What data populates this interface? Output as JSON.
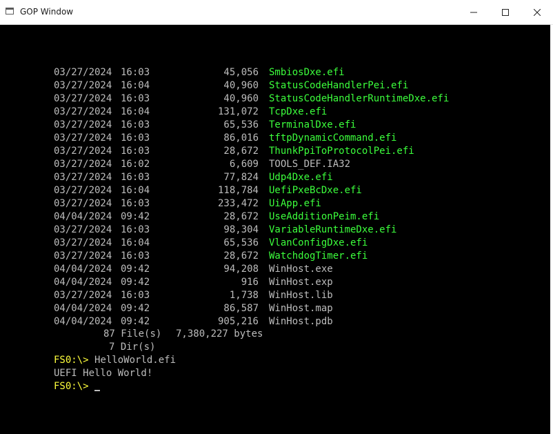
{
  "window": {
    "title": "GOP Window",
    "controls": {
      "minimize": "minimize",
      "maximize": "maximize",
      "close": "close"
    }
  },
  "listing": [
    {
      "date": "03/27/2024",
      "time": "16:03",
      "size": "45,056",
      "name": "SmbiosDxe.efi",
      "color": "green"
    },
    {
      "date": "03/27/2024",
      "time": "16:04",
      "size": "40,960",
      "name": "StatusCodeHandlerPei.efi",
      "color": "green"
    },
    {
      "date": "03/27/2024",
      "time": "16:03",
      "size": "40,960",
      "name": "StatusCodeHandlerRuntimeDxe.efi",
      "color": "green"
    },
    {
      "date": "03/27/2024",
      "time": "16:04",
      "size": "131,072",
      "name": "TcpDxe.efi",
      "color": "green"
    },
    {
      "date": "03/27/2024",
      "time": "16:03",
      "size": "65,536",
      "name": "TerminalDxe.efi",
      "color": "green"
    },
    {
      "date": "03/27/2024",
      "time": "16:03",
      "size": "86,016",
      "name": "tftpDynamicCommand.efi",
      "color": "green"
    },
    {
      "date": "03/27/2024",
      "time": "16:03",
      "size": "28,672",
      "name": "ThunkPpiToProtocolPei.efi",
      "color": "green"
    },
    {
      "date": "03/27/2024",
      "time": "16:02",
      "size": "6,609",
      "name": "TOOLS_DEF.IA32",
      "color": "gray"
    },
    {
      "date": "03/27/2024",
      "time": "16:03",
      "size": "77,824",
      "name": "Udp4Dxe.efi",
      "color": "green"
    },
    {
      "date": "03/27/2024",
      "time": "16:04",
      "size": "118,784",
      "name": "UefiPxeBcDxe.efi",
      "color": "green"
    },
    {
      "date": "03/27/2024",
      "time": "16:03",
      "size": "233,472",
      "name": "UiApp.efi",
      "color": "green"
    },
    {
      "date": "04/04/2024",
      "time": "09:42",
      "size": "28,672",
      "name": "UseAdditionPeim.efi",
      "color": "green"
    },
    {
      "date": "03/27/2024",
      "time": "16:03",
      "size": "98,304",
      "name": "VariableRuntimeDxe.efi",
      "color": "green"
    },
    {
      "date": "03/27/2024",
      "time": "16:04",
      "size": "65,536",
      "name": "VlanConfigDxe.efi",
      "color": "green"
    },
    {
      "date": "03/27/2024",
      "time": "16:03",
      "size": "28,672",
      "name": "WatchdogTimer.efi",
      "color": "green"
    },
    {
      "date": "04/04/2024",
      "time": "09:42",
      "size": "94,208",
      "name": "WinHost.exe",
      "color": "gray"
    },
    {
      "date": "04/04/2024",
      "time": "09:42",
      "size": "916",
      "name": "WinHost.exp",
      "color": "gray"
    },
    {
      "date": "03/27/2024",
      "time": "16:03",
      "size": "1,738",
      "name": "WinHost.lib",
      "color": "gray"
    },
    {
      "date": "04/04/2024",
      "time": "09:42",
      "size": "86,587",
      "name": "WinHost.map",
      "color": "gray"
    },
    {
      "date": "04/04/2024",
      "time": "09:42",
      "size": "905,216",
      "name": "WinHost.pdb",
      "color": "gray"
    }
  ],
  "summary": {
    "files_count": "87",
    "files_label": "File(s)",
    "bytes_value": "7,380,227",
    "bytes_label": "bytes",
    "dirs_count": "7",
    "dirs_label": "Dir(s)"
  },
  "session": {
    "prompt": "FS0:\\>",
    "command": "HelloWorld.efi",
    "output": "UEFI Hello World!",
    "prompt2": "FS0:\\>"
  },
  "colors": {
    "exec": "#3cff3c",
    "text": "#bdbdbd",
    "prompt": "#ffff3c",
    "background": "#000000"
  }
}
